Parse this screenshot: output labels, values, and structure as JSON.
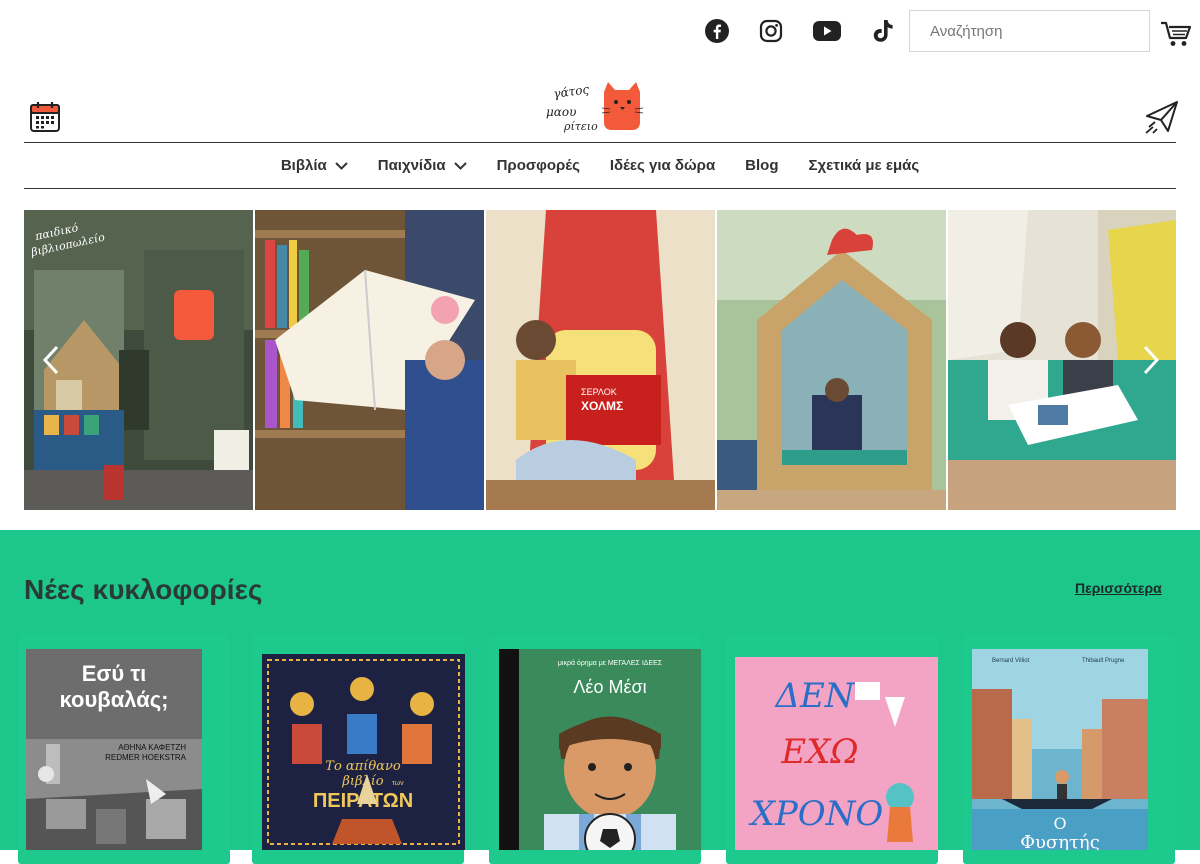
{
  "header": {
    "search_placeholder": "Αναζήτηση",
    "social": [
      "facebook-icon",
      "instagram-icon",
      "youtube-icon",
      "tiktok-icon"
    ],
    "logo_text": [
      "γάτος",
      "μαου",
      "ρίτειο"
    ]
  },
  "nav": {
    "items": [
      {
        "label": "Βιβλία",
        "has_dropdown": true
      },
      {
        "label": "Παιχνίδια",
        "has_dropdown": true
      },
      {
        "label": "Προσφορές",
        "has_dropdown": false
      },
      {
        "label": "Ιδέες για δώρα",
        "has_dropdown": false
      },
      {
        "label": "Blog",
        "has_dropdown": false
      },
      {
        "label": "Σχετικά με εμάς",
        "has_dropdown": false
      }
    ]
  },
  "slider": {
    "storefront_sign": [
      "παιδικό",
      "βιβλιοπωλείο"
    ],
    "book_in_photo": [
      "ΣΕΡΛΟΚ",
      "ΧΟΛΜΣ"
    ]
  },
  "new_releases": {
    "title": "Νέες κυκλοφορίες",
    "more_label": "Περισσότερα",
    "books": [
      {
        "cover_title": [
          "Εσύ τι",
          "κουβαλάς;"
        ],
        "cover_authors": [
          "ΑΘΗΝΑ ΚΑΦΕΤΖΗ",
          "REDMER HOEKSTRA"
        ]
      },
      {
        "cover_title": [
          "Το απίθανο",
          "βιβλίο",
          "των",
          "ΠΕΙΡΑΤΩΝ"
        ]
      },
      {
        "cover_top": "μικρά όρημα με ΜΕΓΑΛΕΣ ΙΔΕΕΣ",
        "cover_title": [
          "Λέο Μέσι"
        ]
      },
      {
        "cover_title": [
          "ΔΕΝ",
          "ΕΧΩ",
          "ΧΡΟΝΟ"
        ]
      },
      {
        "cover_authors": [
          "Bernard Villiot",
          "Thibault Prugne"
        ],
        "cover_title": [
          "Ο",
          "Φυσητής"
        ]
      }
    ]
  },
  "colors": {
    "green": "#1dc68a",
    "logo_cat": "#f25a3b",
    "dark": "#333333"
  }
}
